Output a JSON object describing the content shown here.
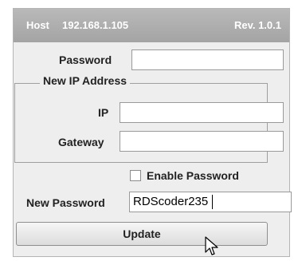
{
  "header": {
    "host_label": "Host",
    "host_ip": "192.168.1.105",
    "revision": "Rev. 1.0.1"
  },
  "form": {
    "password_label": "Password",
    "password_value": "",
    "group_title": "New IP Address",
    "ip_label": "IP",
    "ip_value": "",
    "gateway_label": "Gateway",
    "gateway_value": "",
    "enable_password_label": "Enable Password",
    "enable_password_checked": false,
    "new_password_label": "New Password",
    "new_password_value": "RDScoder235",
    "update_button_label": "Update"
  },
  "cursor_icon": "arrow-pointer-icon"
}
